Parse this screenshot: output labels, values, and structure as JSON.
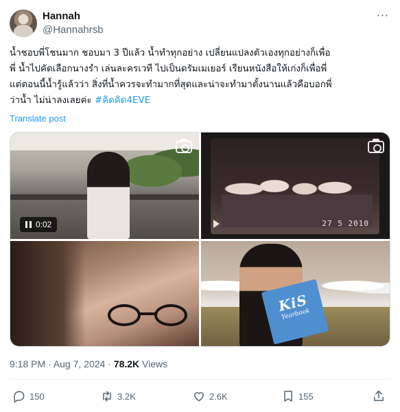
{
  "author": {
    "display_name": "Hannah",
    "handle": "@Hannahrsb"
  },
  "menu": {
    "more_icon": "more-horizontal-icon",
    "more_glyph": "···"
  },
  "tweet": {
    "lines": [
      "น้ำชอบพี่โชนมาก ชอบมา 3 ปีแล้ว น้ำทำทุกอย่าง เปลี่ยนแปลงตัวเองทุกอย่างก็เพื่อ",
      "พี่ น้ำไปคัดเลือกนางรำ เล่นละครเวที ไปเป็นดรัมเมเยอร์ เรียนหนังสือให้เก่งก็เพื่อพี่",
      "แต่ตอนนี้น้ำรู้แล้วว่า สิ่งที่น้ำควรจะทำมากที่สุดและน่าจะทำมาตั้งนานแล้วคือบอกพี่"
    ],
    "last_line": "ว่าน้ำ ไม่น่าลงเลยค่ะ ",
    "hashtag": "#คิดคิด4EVE",
    "translate_label": "Translate post"
  },
  "media": {
    "video_time": "0:02",
    "video_stamp": "27  5 2010",
    "book_title": "KiS",
    "book_subtitle": "Yearbook"
  },
  "meta": {
    "time": "9:18 PM",
    "separator": " · ",
    "date": "Aug 7, 2024",
    "views_count": "78.2K",
    "views_label": " Views"
  },
  "actions": {
    "reply_count": "150",
    "retweet_count": "3.2K",
    "like_count": "2.6K",
    "bookmark_count": "155"
  },
  "colors": {
    "accent": "#1d9bf0",
    "text_primary": "#0f1419",
    "text_secondary": "#536471",
    "divider": "#eff3f4"
  }
}
